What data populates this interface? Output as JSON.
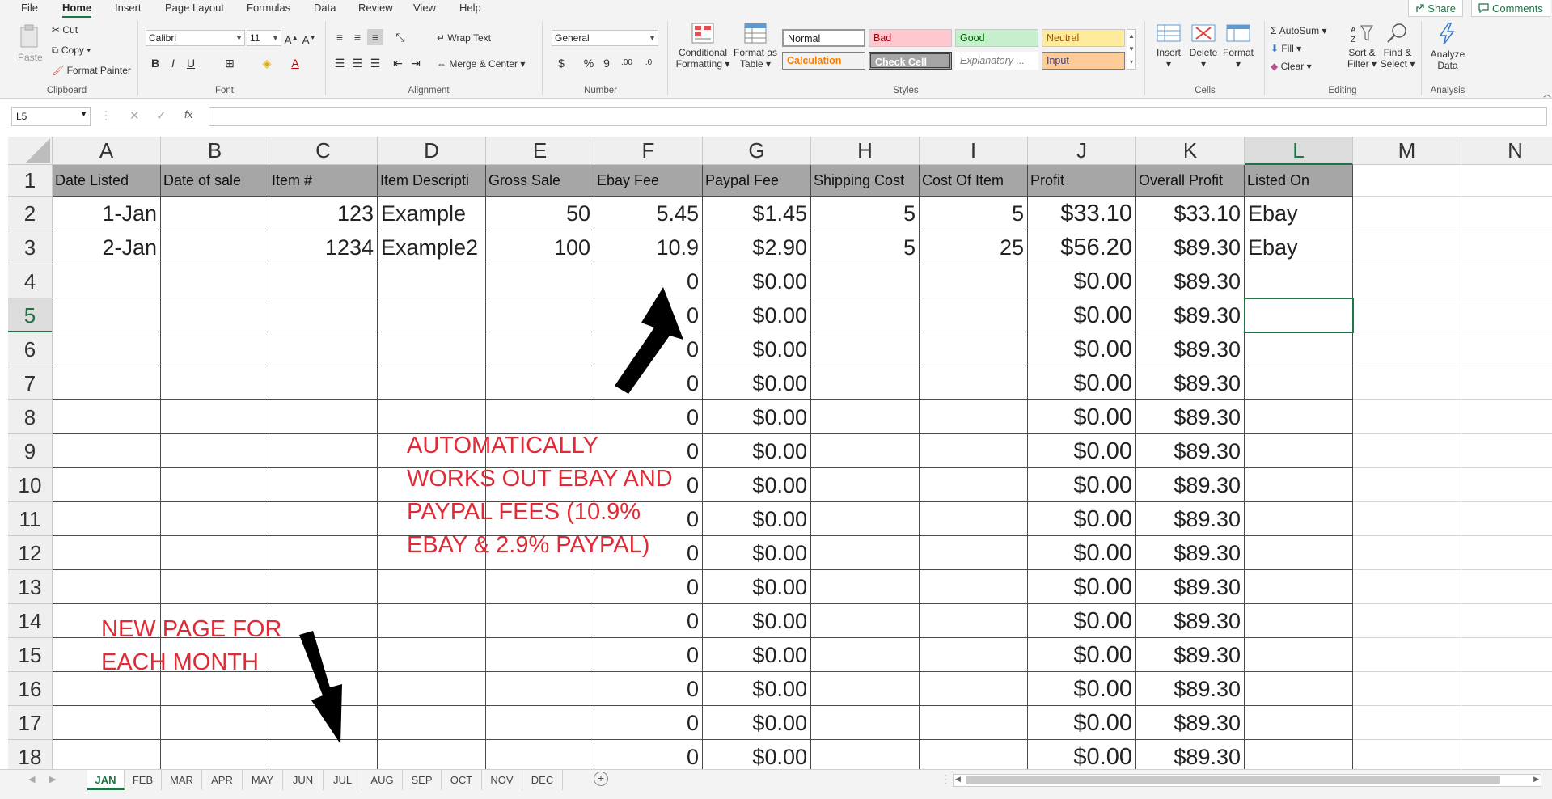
{
  "menu": {
    "tabs": [
      "File",
      "Home",
      "Insert",
      "Page Layout",
      "Formulas",
      "Data",
      "Review",
      "View",
      "Help"
    ],
    "active_tab": "Home",
    "share_label": "Share",
    "comments_label": "Comments"
  },
  "ribbon": {
    "clipboard": {
      "paste": "Paste",
      "cut": "Cut",
      "copy": "Copy",
      "format_painter": "Format Painter",
      "label": "Clipboard"
    },
    "font": {
      "name": "Calibri",
      "size": "11",
      "label": "Font"
    },
    "alignment": {
      "wrap_text": "Wrap Text",
      "merge_center": "Merge & Center",
      "label": "Alignment"
    },
    "number": {
      "format": "General",
      "label": "Number"
    },
    "styles": {
      "conditional_line1": "Conditional",
      "conditional_line2": "Formatting",
      "format_table_line1": "Format as",
      "format_table_line2": "Table",
      "normal": "Normal",
      "bad": "Bad",
      "good": "Good",
      "neutral": "Neutral",
      "calculation": "Calculation",
      "check_cell": "Check Cell",
      "explanatory": "Explanatory ...",
      "input": "Input",
      "label": "Styles"
    },
    "cells": {
      "insert": "Insert",
      "delete": "Delete",
      "format": "Format",
      "label": "Cells"
    },
    "editing": {
      "autosum": "AutoSum",
      "fill": "Fill",
      "clear": "Clear",
      "sort_line1": "Sort &",
      "sort_line2": "Filter",
      "find_line1": "Find &",
      "find_line2": "Select",
      "label": "Editing"
    },
    "analysis": {
      "analyze_line1": "Analyze",
      "analyze_line2": "Data",
      "label": "Analysis"
    }
  },
  "formula_bar": {
    "name_box": "L5",
    "fx": "fx",
    "value": ""
  },
  "sheet": {
    "columns": [
      "A",
      "B",
      "C",
      "D",
      "E",
      "F",
      "G",
      "H",
      "I",
      "J",
      "K",
      "L",
      "M",
      "N"
    ],
    "selected_column": "L",
    "selected_row": "5",
    "headers": [
      "Date Listed",
      "Date of sale",
      "Item #",
      "Item Descripti",
      "Gross Sale",
      "Ebay Fee",
      "Paypal Fee",
      "Shipping Cost",
      "Cost Of Item",
      "Profit",
      "Overall Profit",
      "Listed On",
      "",
      ""
    ],
    "rows": [
      {
        "num": "2",
        "A": "1-Jan",
        "B": "",
        "C": "123",
        "D": "Example",
        "E": "50",
        "F": "5.45",
        "G": "$1.45",
        "H": "5",
        "I": "5",
        "J": "$33.10",
        "K": "$33.10",
        "L": "Ebay"
      },
      {
        "num": "3",
        "A": "2-Jan",
        "B": "",
        "C": "1234",
        "D": "Example2",
        "E": "100",
        "F": "10.9",
        "G": "$2.90",
        "H": "5",
        "I": "25",
        "J": "$56.20",
        "K": "$89.30",
        "L": "Ebay"
      },
      {
        "num": "4",
        "F": "0",
        "G": "$0.00",
        "J": "$0.00",
        "K": "$89.30"
      },
      {
        "num": "5",
        "F": "0",
        "G": "$0.00",
        "J": "$0.00",
        "K": "$89.30"
      },
      {
        "num": "6",
        "F": "0",
        "G": "$0.00",
        "J": "$0.00",
        "K": "$89.30"
      },
      {
        "num": "7",
        "F": "0",
        "G": "$0.00",
        "J": "$0.00",
        "K": "$89.30"
      },
      {
        "num": "8",
        "F": "0",
        "G": "$0.00",
        "J": "$0.00",
        "K": "$89.30"
      },
      {
        "num": "9",
        "F": "0",
        "G": "$0.00",
        "J": "$0.00",
        "K": "$89.30"
      },
      {
        "num": "10",
        "F": "0",
        "G": "$0.00",
        "J": "$0.00",
        "K": "$89.30"
      },
      {
        "num": "11",
        "F": "0",
        "G": "$0.00",
        "J": "$0.00",
        "K": "$89.30"
      },
      {
        "num": "12",
        "F": "0",
        "G": "$0.00",
        "J": "$0.00",
        "K": "$89.30"
      },
      {
        "num": "13",
        "F": "0",
        "G": "$0.00",
        "J": "$0.00",
        "K": "$89.30"
      },
      {
        "num": "14",
        "F": "0",
        "G": "$0.00",
        "J": "$0.00",
        "K": "$89.30"
      },
      {
        "num": "15",
        "F": "0",
        "G": "$0.00",
        "J": "$0.00",
        "K": "$89.30"
      },
      {
        "num": "16",
        "F": "0",
        "G": "$0.00",
        "J": "$0.00",
        "K": "$89.30"
      },
      {
        "num": "17",
        "F": "0",
        "G": "$0.00",
        "J": "$0.00",
        "K": "$89.30"
      },
      {
        "num": "18",
        "F": "0",
        "G": "$0.00",
        "J": "$0.00",
        "K": "$89.30"
      }
    ]
  },
  "annotations": {
    "fees_line1": "AUTOMATICALLY",
    "fees_line2": "WORKS OUT EBAY AND",
    "fees_line3": "PAYPAL FEES (10.9%",
    "fees_line4": "EBAY & 2.9% PAYPAL)",
    "month_line1": "NEW PAGE FOR",
    "month_line2": "EACH MONTH"
  },
  "sheet_tabs": [
    "JAN",
    "FEB",
    "MAR",
    "APR",
    "MAY",
    "JUN",
    "JUL",
    "AUG",
    "SEP",
    "OCT",
    "NOV",
    "DEC"
  ],
  "active_sheet": "JAN",
  "colors": {
    "accent": "#217346",
    "header_fill": "#a6a6a6",
    "annotation": "#e02a36",
    "bad_fill": "#ffc7ce",
    "good_fill": "#c6efce",
    "neutral_fill": "#ffeb9c",
    "input_fill": "#ffcc99"
  }
}
